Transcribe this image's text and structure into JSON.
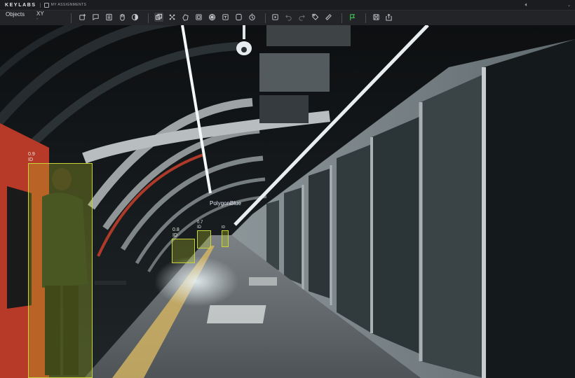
{
  "app": {
    "logo": "KEYLABS",
    "assignments_label": "MY ASSIGNMENTS"
  },
  "titlebar": {
    "sound_icon": "speaker-icon",
    "dropdown_icon": "chevron-down-icon"
  },
  "sidebar": {
    "tab_label": "Objects",
    "class_value": "XY",
    "class_sub": "-"
  },
  "toolbar": {
    "groups": [
      [
        "add-object-icon",
        "comment-icon",
        "list-icon",
        "hand-icon",
        "contrast-icon"
      ],
      [
        "bounding-box-icon",
        "keypoints-icon",
        "polygon-icon",
        "cuboid-icon",
        "mask-icon",
        "segment-icon",
        "ellipse-icon",
        "timer-icon"
      ],
      [
        "fit-screen-icon",
        "undo-icon",
        "redo-icon",
        "tag-icon",
        "ruler-icon"
      ],
      [
        "flag-icon"
      ],
      [
        "save-icon",
        "export-icon"
      ]
    ],
    "accent_flag": "#3ec453"
  },
  "annotations": [
    {
      "score": "0.9",
      "id_label": "ID"
    },
    {
      "score": "0.8",
      "id_label": "ID"
    },
    {
      "score": "0.7",
      "id_label": "ID"
    },
    {
      "score": "",
      "id_label": "ID"
    }
  ],
  "polygon_label": "PolygonBlue",
  "colors": {
    "bbox_stroke": "#c8d43a",
    "bbox_fill": "rgba(190,210,40,0.28)",
    "toolbar_bg": "#232428"
  }
}
